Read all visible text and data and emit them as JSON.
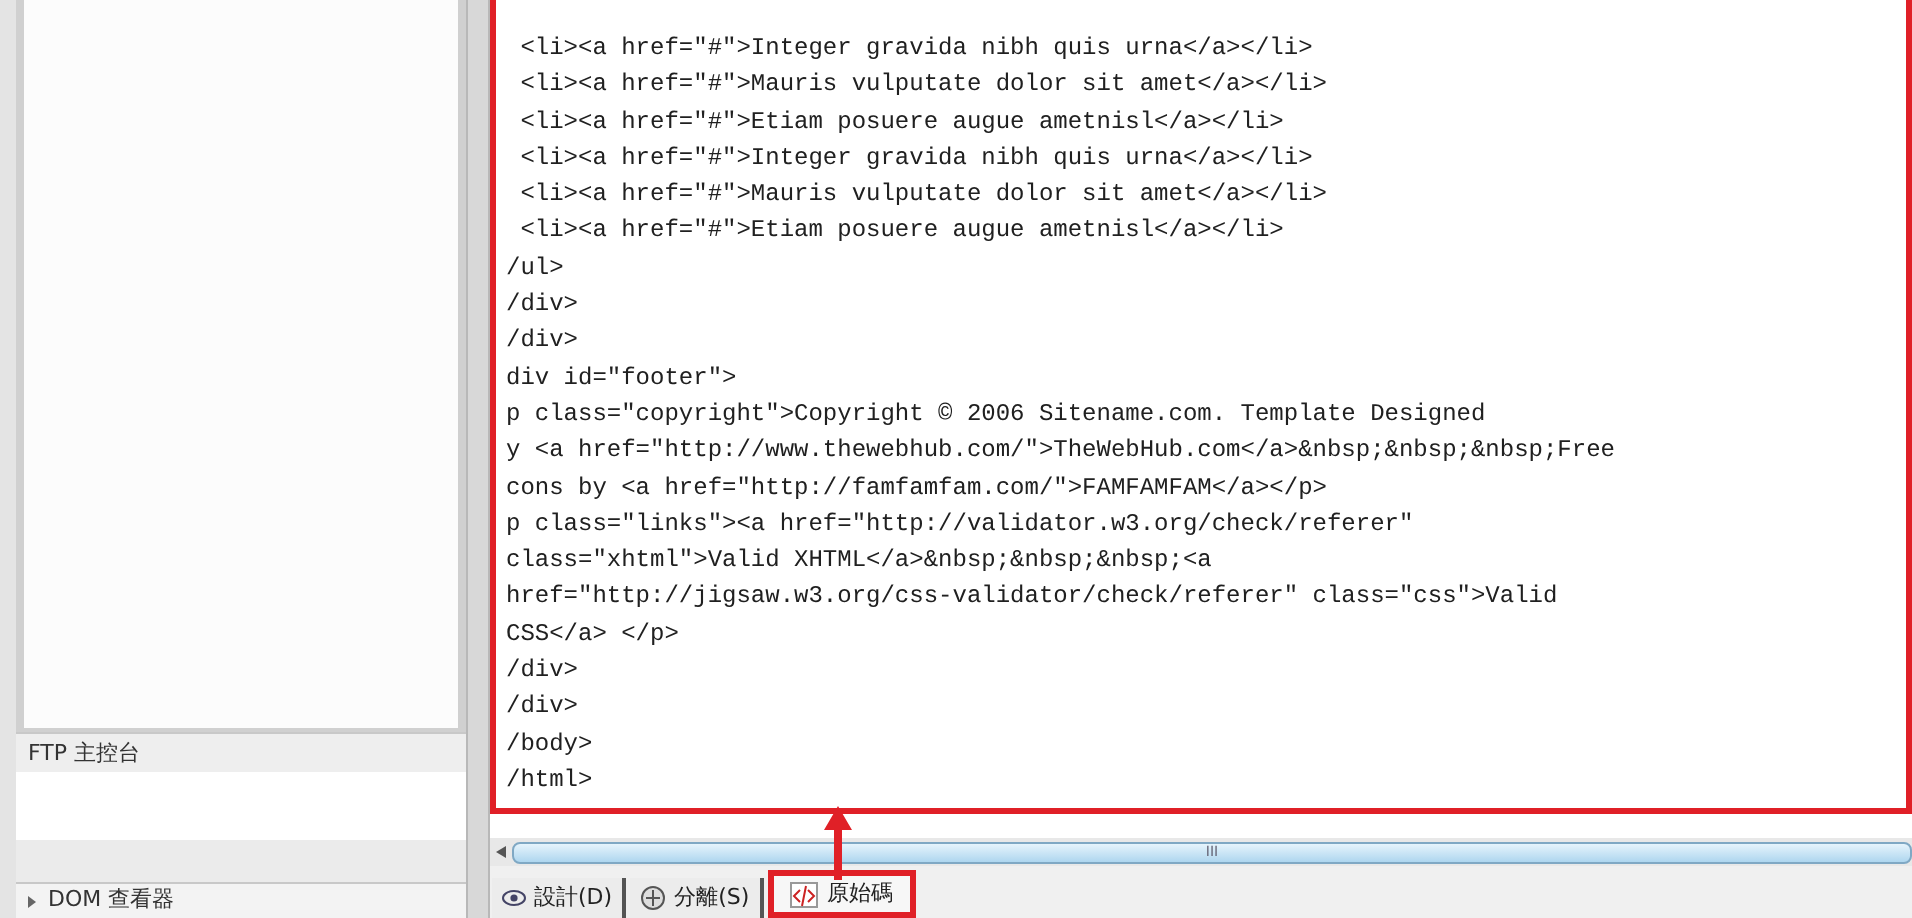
{
  "panels": [
    {
      "title": "FTP 主控台",
      "kind": "panel"
    },
    {
      "title": "DOM 查看器",
      "kind": "collapsed"
    }
  ],
  "code_lines": [
    " <li><a href=\"#\">Integer gravida nibh quis urna</a></li>",
    " <li><a href=\"#\">Mauris vulputate dolor sit amet</a></li>",
    " <li><a href=\"#\">Etiam posuere augue ametnisl</a></li>",
    " <li><a href=\"#\">Integer gravida nibh quis urna</a></li>",
    " <li><a href=\"#\">Mauris vulputate dolor sit amet</a></li>",
    " <li><a href=\"#\">Etiam posuere augue ametnisl</a></li>",
    "/ul>",
    "/div>",
    "/div>",
    "div id=\"footer\">",
    "p class=\"copyright\">Copyright © 2006 Sitename.com. Template Designed",
    "y <a href=\"http://www.thewebhub.com/\">TheWebHub.com</a>&nbsp;&nbsp;&nbsp;Free",
    "cons by <a href=\"http://famfamfam.com/\">FAMFAMFAM</a></p>",
    "p class=\"links\"><a href=\"http://validator.w3.org/check/referer\"",
    "class=\"xhtml\">Valid XHTML</a>&nbsp;&nbsp;&nbsp;<a",
    "href=\"http://jigsaw.w3.org/css-validator/check/referer\" class=\"css\">Valid",
    "CSS</a> </p>",
    "/div>",
    "/div>",
    "/body>",
    "/html>"
  ],
  "scroll_grip": "III",
  "view_tabs": [
    {
      "label": "設計(D)",
      "kind": "design",
      "selected": false
    },
    {
      "label": "分離(S)",
      "kind": "split",
      "selected": false
    },
    {
      "label": "原始碼",
      "kind": "code",
      "selected": true
    }
  ]
}
